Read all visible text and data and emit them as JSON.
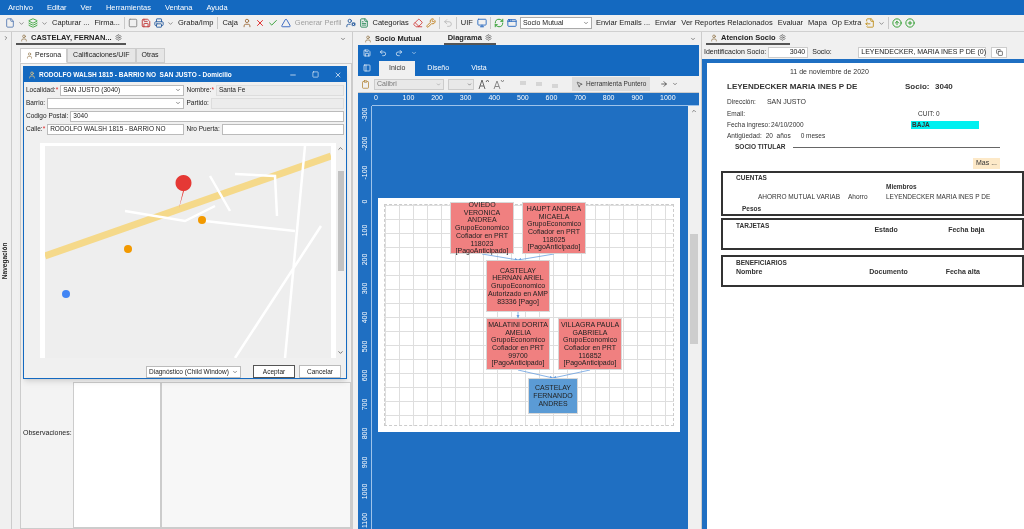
{
  "menu": [
    "Archivo",
    "Editar",
    "Ver",
    "Herramientas",
    "Ventana",
    "Ayuda"
  ],
  "toolbar": [
    {
      "kind": "icon",
      "disabled": false
    },
    {
      "kind": "caret"
    },
    {
      "kind": "icon",
      "disabled": false
    },
    {
      "kind": "caret"
    },
    {
      "kind": "button",
      "label": "Capturar ...",
      "disabled": false
    },
    {
      "kind": "button",
      "label": "Firma...",
      "disabled": false
    },
    {
      "kind": "sep"
    },
    {
      "kind": "icon",
      "disabled": false
    },
    {
      "kind": "icon",
      "disabled": false
    },
    {
      "kind": "icon",
      "disabled": false
    },
    {
      "kind": "caret"
    },
    {
      "kind": "button",
      "label": "Graba/Imp",
      "disabled": false
    },
    {
      "kind": "sep"
    },
    {
      "kind": "button",
      "label": "Caja",
      "disabled": false
    },
    {
      "kind": "icon",
      "disabled": false
    },
    {
      "kind": "icon",
      "disabled": false
    },
    {
      "kind": "icon",
      "disabled": false
    },
    {
      "kind": "icon",
      "disabled": false
    },
    {
      "kind": "button",
      "label": "Generar Perfil",
      "disabled": true
    },
    {
      "kind": "icon",
      "disabled": false
    },
    {
      "kind": "icon",
      "disabled": false
    },
    {
      "kind": "button",
      "label": "Categorias",
      "disabled": false
    },
    {
      "kind": "icon",
      "disabled": false
    },
    {
      "kind": "icon",
      "disabled": false
    },
    {
      "kind": "sep"
    },
    {
      "kind": "icon",
      "disabled": true
    },
    {
      "kind": "sep"
    },
    {
      "kind": "button",
      "label": "UIF",
      "disabled": false
    },
    {
      "kind": "icon",
      "disabled": false
    },
    {
      "kind": "sep"
    },
    {
      "kind": "icon",
      "disabled": false
    },
    {
      "kind": "icon",
      "disabled": false
    },
    {
      "kind": "select",
      "label": "Socio Mutual"
    },
    {
      "kind": "button",
      "label": "Enviar Emails ...",
      "disabled": false
    },
    {
      "kind": "button",
      "label": "Enviar",
      "disabled": false
    },
    {
      "kind": "button",
      "label": "Ver Reportes Relacionados",
      "disabled": false
    },
    {
      "kind": "button",
      "label": "Evaluar",
      "disabled": false
    },
    {
      "kind": "button",
      "label": "Mapa",
      "disabled": false
    },
    {
      "kind": "button",
      "label": "Op Extra",
      "disabled": false
    },
    {
      "kind": "icon",
      "disabled": false
    },
    {
      "kind": "caret"
    },
    {
      "kind": "sep"
    },
    {
      "kind": "icon",
      "disabled": false
    },
    {
      "kind": "icon",
      "disabled": false
    }
  ],
  "navigation": {
    "label": "Navegación"
  },
  "left_pane": {
    "tab": {
      "label": "CASTELAY, FERNAN...",
      "selected": true
    },
    "inner_tabs": [
      {
        "label": "Persona",
        "selected": true
      },
      {
        "label": "Calificaciones/UIF",
        "selected": false
      },
      {
        "label": "Otras",
        "selected": false
      }
    ],
    "observations_label": "Observaciones:"
  },
  "dialog": {
    "title": "RODOLFO WALSH 1815 - BARRIO NO  SAN JUSTO - Domicilio",
    "rows": [
      [
        {
          "label": "Localidad:",
          "mark": "*",
          "kind": "select",
          "value": "SAN JUSTO (3040)"
        },
        {
          "label": "Nombre:",
          "mark": "*",
          "kind": "readonly",
          "value": "Santa Fe"
        }
      ],
      [
        {
          "label": "Barrio:",
          "kind": "select"
        },
        {
          "label": "Partido:",
          "kind": "readonly"
        }
      ],
      [
        {
          "label": "Codigo Postal:",
          "kind": "text",
          "value": "3040"
        }
      ],
      [
        {
          "label": "Calle:",
          "mark": "*",
          "kind": "text",
          "value": "RODOLFO WALSH 1815 - BARRIO NO"
        },
        {
          "label": "Nro Puerta:",
          "kind": "text"
        }
      ]
    ],
    "view_select": "Diagnóstico (Child Window)",
    "buttons": [
      "Aceptar",
      "Cancelar"
    ]
  },
  "middle_pane": {
    "tabs": [
      {
        "label": "Socio Mutual",
        "selected": false
      },
      {
        "label": "Diagrama",
        "selected": true
      }
    ],
    "ribbon_tabs": [
      {
        "label": "Inicio",
        "selected": true
      },
      {
        "label": "Diseño",
        "selected": false
      },
      {
        "label": "Vista",
        "selected": false
      }
    ],
    "font": "Calibri",
    "tool": "Herramienta Puntero",
    "x_ruler": [
      "0",
      "100",
      "200",
      "300",
      "400",
      "500",
      "600",
      "700",
      "800",
      "900",
      "1000"
    ],
    "y_ruler": [
      "-300",
      "-200",
      "-100",
      "0",
      "100",
      "200",
      "300",
      "400",
      "500",
      "600",
      "700",
      "800",
      "900",
      "1000",
      "1100"
    ],
    "nodes": [
      {
        "text": "OVIEDO VERONICA ANDREA GrupoEconomico Cofiador en PRT 118023 [PagoAnticipado]",
        "color": "#f08080"
      },
      {
        "text": "HAUPT ANDREA MICAELA GrupoEconomico Cofiador en PRT 118025 [PagoAnticipado]",
        "color": "#f08080"
      },
      {
        "text": "CASTELAY HERNAN ARIEL GrupoEconomico Autorizado en AMP 83336 [Pago]",
        "color": "#f08080"
      },
      {
        "text": "MALATINI DORITA AMELIA GrupoEconomico Cofiador en PRT 99700 [PagoAnticipado]",
        "color": "#f08080"
      },
      {
        "text": "VILLAGRA PAULA GABRIELA GrupoEconomico Cofiador en PRT 116852 [PagoAnticipado]",
        "color": "#f08080"
      },
      {
        "text": "CASTELAY FERNANDO ANDRES",
        "color": "#5b9bd5"
      }
    ]
  },
  "right_pane": {
    "tab": {
      "label": "Atencion Socio",
      "selected": true
    },
    "id_label": "Identificacion Socio:",
    "id_value": "3040",
    "socio_label": "Socio:",
    "socio_value": "LEYENDECKER, MARIA INES P DE (0)",
    "report": {
      "date": "11 de noviembre de 2020",
      "name": "LEYENDECKER MARIA INES P DE",
      "socio_label": "Socio:",
      "socio_number": "3040",
      "address_label": "Dirección:",
      "address": "SAN JUSTO",
      "email_label": "Email:",
      "cuit": "CUIT: 0",
      "ingreso_label": "Fecha ingreso:",
      "ingreso": "24/10/2000",
      "status": "BAJA",
      "antiguedad_label": "Antigüedad:",
      "antiguedad": "20  años",
      "meses": "0 meses",
      "titular": "SOCIO TITULAR",
      "more": "Mas ...",
      "cuentas": {
        "title": "CUENTAS",
        "header": "Miembros",
        "row": [
          "AHORRO MUTUAL VARIAB",
          "Ahorro",
          "LEYENDECKER MARIA INES P DE"
        ],
        "footer": "Pesos"
      },
      "tarjetas": {
        "title": "TARJETAS",
        "columns": [
          "Estado",
          "Fecha baja"
        ]
      },
      "beneficiarios": {
        "title": "BENEFICIARIOS",
        "columns": [
          "Nombre",
          "Documento",
          "Fecha alta"
        ]
      }
    }
  }
}
